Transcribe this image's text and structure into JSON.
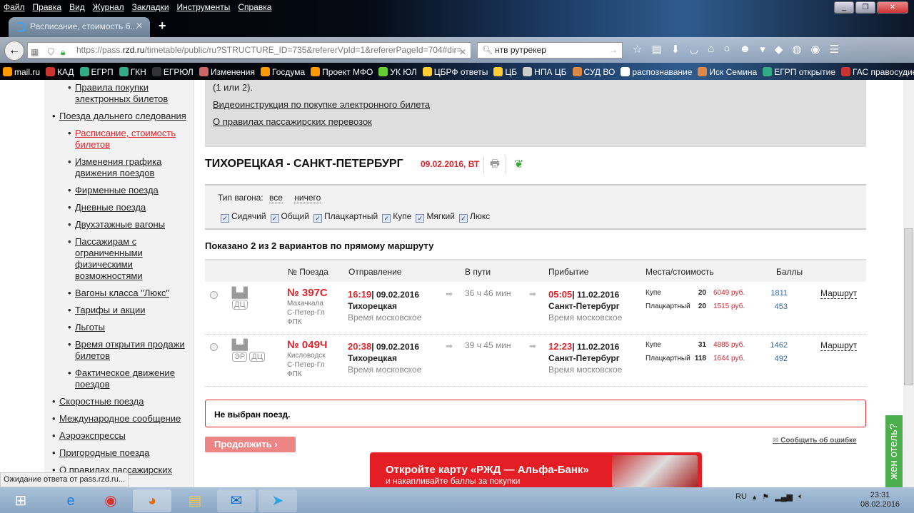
{
  "browser": {
    "menu": [
      "Файл",
      "Правка",
      "Вид",
      "Журнал",
      "Закладки",
      "Инструменты",
      "Справка"
    ],
    "tab_title": "Расписание, стоимость б...",
    "url_prefix": "https://pass.",
    "url_domain": "rzd.ru",
    "url_rest": "/timetable/public/ru?STRUCTURE_ID=735&refererVpId=1&refererPageId=704#dir=",
    "search_value": "нтв рутрекер",
    "bookmarks": [
      "mail.ru",
      "КАД",
      "ЕГРП",
      "ГКН",
      "ЕГРЮЛ",
      "Изменения",
      "Госдума",
      "Проект МФО",
      "УК ЮЛ",
      "ЦБРФ ответы",
      "ЦБ",
      "НПА ЦБ",
      "СУД ВО",
      "распознавание",
      "Иск Семина",
      "ЕГРП открытие",
      "ГАС правосудие"
    ],
    "status": "Ожидание ответа от pass.rzd.ru..."
  },
  "sidebar": {
    "items": [
      {
        "label": "Правила покупки электронных билетов",
        "level": 2
      },
      {
        "label": "Поезда дальнего следования",
        "level": 1
      },
      {
        "label": "Расписание, стоимость билетов",
        "level": 2,
        "active": true
      },
      {
        "label": "Изменения графика движения поездов",
        "level": 2
      },
      {
        "label": "Фирменные поезда",
        "level": 2
      },
      {
        "label": "Дневные поезда",
        "level": 2
      },
      {
        "label": "Двухэтажные вагоны",
        "level": 2
      },
      {
        "label": "Пассажирам с ограниченными физическими возможностями",
        "level": 2
      },
      {
        "label": "Вагоны класса \"Люкс\"",
        "level": 2
      },
      {
        "label": "Тарифы и акции",
        "level": 2
      },
      {
        "label": "Льготы",
        "level": 2
      },
      {
        "label": "Время открытия продажи билетов",
        "level": 2
      },
      {
        "label": "Фактическое движение поездов",
        "level": 2
      },
      {
        "label": "Скоростные поезда",
        "level": 1
      },
      {
        "label": "Международное сообщение",
        "level": 1
      },
      {
        "label": "Аэроэкспрессы",
        "level": 1
      },
      {
        "label": "Пригородные поезда",
        "level": 1
      },
      {
        "label": "О правилах пассажирских",
        "level": 1
      }
    ]
  },
  "info": {
    "line0": "(1 или 2).",
    "link1": "Видеоинструкция по покупке электронного билета",
    "link2": "О правилах пассажирских перевозок"
  },
  "route": {
    "title": "ТИХОРЕЦКАЯ - САНКТ-ПЕТЕРБУРГ",
    "date": "09.02.2016, ВТ"
  },
  "filter": {
    "label": "Тип вагона:",
    "all": "все",
    "none": "ничего",
    "types": [
      "Сидячий",
      "Общий",
      "Плацкартный",
      "Купе",
      "Мягкий",
      "Люкс"
    ]
  },
  "shown": "Показано 2 из 2 вариантов по прямому маршруту",
  "columns": [
    "№ Поезда",
    "Отправление",
    "В пути",
    "Прибытие",
    "Места/стоимость",
    "Баллы"
  ],
  "trains": [
    {
      "badges": [
        "ДЦ"
      ],
      "number": "№ 397С",
      "route1": "Махачкала",
      "route2": "С-Петер-Гл",
      "carrier": "ФПК",
      "dep_time": "16:19",
      "dep_date": "| 09.02.2016",
      "dep_station": "Тихорецкая",
      "tz": "Время московское",
      "duration": "36 ч 46 мин",
      "arr_time": "05:05",
      "arr_date": "| 11.02.2016",
      "arr_station": "Санкт-Петербург",
      "arr_tz": "Время московское",
      "seats": [
        {
          "type": "Купе",
          "count": "20",
          "price": "6049 руб.",
          "points": "1811"
        },
        {
          "type": "Плацкартный",
          "count": "20",
          "price": "1515 руб.",
          "points": "453"
        }
      ],
      "link": "Маршрут"
    },
    {
      "badges": [
        "ЭР",
        "ДЦ"
      ],
      "number": "№ 049Ч",
      "route1": "Кисловодск",
      "route2": "С-Петер-Гл",
      "carrier": "ФПК",
      "dep_time": "20:38",
      "dep_date": "| 09.02.2016",
      "dep_station": "Тихорецкая",
      "tz": "Время московское",
      "duration": "39 ч 45 мин",
      "arr_time": "12:23",
      "arr_date": "| 11.02.2016",
      "arr_station": "Санкт-Петербург",
      "arr_tz": "Время московское",
      "seats": [
        {
          "type": "Купе",
          "count": "31",
          "price": "4885 руб.",
          "points": "1462"
        },
        {
          "type": "Плацкартный",
          "count": "118",
          "price": "1644 руб.",
          "points": "492"
        }
      ],
      "link": "Маршрут"
    }
  ],
  "warning": "Не выбран поезд.",
  "continue": "Продолжить",
  "report": "Сообщить об ошибке",
  "banner": {
    "title": "Откройте карту «РЖД — Альфа-Банк»",
    "sub": "и накапливайте баллы за покупки"
  },
  "hotel_tab": "жен отель?",
  "taskbar": {
    "lang": "RU",
    "time": "23:31",
    "date": "08.02.2016"
  }
}
